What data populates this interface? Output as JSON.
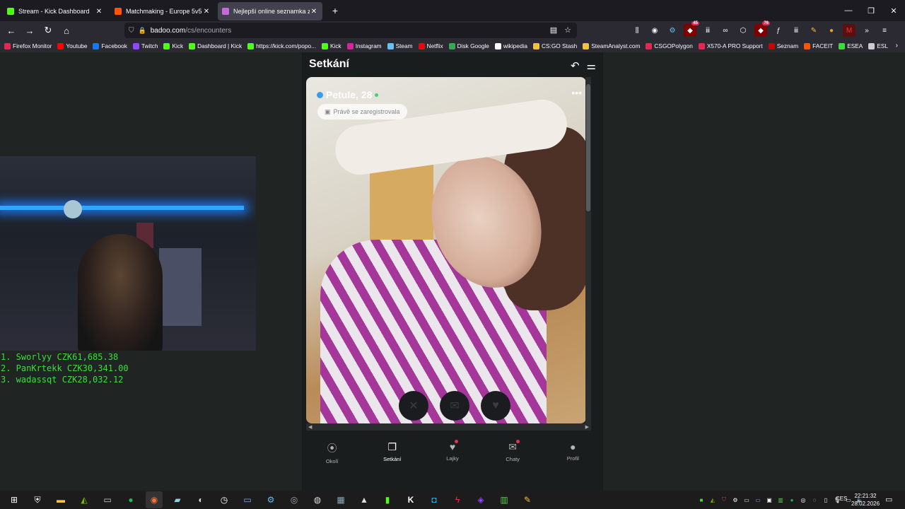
{
  "browser": {
    "tabs": [
      {
        "title": "Stream - Kick Dashboard",
        "icon": "kick-icon",
        "color": "#53fc18",
        "active": false
      },
      {
        "title": "Matchmaking - Europe 5v5 Qu",
        "icon": "faceit-icon",
        "color": "#ff5500",
        "active": false
      },
      {
        "title": "Nejlepší online seznamka zdarm",
        "icon": "badoo-icon",
        "color": "#c76bd8",
        "active": true
      }
    ],
    "url_host": "badoo.com",
    "url_path": "/cs/encounters",
    "badges": {
      "ext1": "45",
      "ext2": "76"
    }
  },
  "bookmarks": [
    {
      "label": "Firefox Monitor",
      "icon": "monitor-icon",
      "color": "#e22850"
    },
    {
      "label": "Youtube",
      "icon": "youtube-icon",
      "color": "#ff0000"
    },
    {
      "label": "Facebook",
      "icon": "facebook-icon",
      "color": "#1877f2"
    },
    {
      "label": "Twitch",
      "icon": "twitch-icon",
      "color": "#9146ff"
    },
    {
      "label": "Kick",
      "icon": "kick-icon",
      "color": "#53fc18"
    },
    {
      "label": "Dashboard | Kick",
      "icon": "kick-icon",
      "color": "#53fc18"
    },
    {
      "label": "https://kick.com/popo...",
      "icon": "kick-icon",
      "color": "#53fc18"
    },
    {
      "label": "Kick",
      "icon": "kick-icon",
      "color": "#53fc18"
    },
    {
      "label": "Instagram",
      "icon": "instagram-icon",
      "color": "#d6249f"
    },
    {
      "label": "Steam",
      "icon": "steam-icon",
      "color": "#66c0f4"
    },
    {
      "label": "Netflix",
      "icon": "netflix-icon",
      "color": "#e50914"
    },
    {
      "label": "Disk Google",
      "icon": "drive-icon",
      "color": "#34a853"
    },
    {
      "label": "wikipedia",
      "icon": "wikipedia-icon",
      "color": "#ffffff"
    },
    {
      "label": "CS:GO Stash",
      "icon": "csgo-icon",
      "color": "#f0c040"
    },
    {
      "label": "SteamAnalyst.com",
      "icon": "steamanalyst-icon",
      "color": "#f0c040"
    },
    {
      "label": "CSGOPolygon",
      "icon": "polygon-icon",
      "color": "#e22850"
    },
    {
      "label": "X570-A PRO Support",
      "icon": "msi-icon",
      "color": "#e22850"
    },
    {
      "label": "Seznam",
      "icon": "seznam-icon",
      "color": "#cc0000"
    },
    {
      "label": "FACEIT",
      "icon": "faceit-icon",
      "color": "#ff5500"
    },
    {
      "label": "ESEA",
      "icon": "esea-icon",
      "color": "#3ddc3a"
    },
    {
      "label": "ESL",
      "icon": "esl-icon",
      "color": "#cccccc"
    }
  ],
  "leaderboard": [
    "1. Sworlyy CZK61,685.38",
    "2. PanKrtekk CZK30,341.00",
    "3. wadassqt CZK28,032.12"
  ],
  "badoo": {
    "title": "Setkání",
    "profile_name": "Petule, 28",
    "status_pill": "Právě se zaregistrovala",
    "nav": [
      {
        "label": "Okolí",
        "icon": "location-pin-icon",
        "active": false
      },
      {
        "label": "Setkání",
        "icon": "cards-icon",
        "active": true
      },
      {
        "label": "Lajky",
        "icon": "heart-icon",
        "active": false
      },
      {
        "label": "Chaty",
        "icon": "chat-icon",
        "active": false
      },
      {
        "label": "Profil",
        "icon": "person-icon",
        "active": false
      }
    ]
  },
  "taskbar": {
    "lang": "CES",
    "time": "22:21:32",
    "date": "28.02.2026"
  }
}
